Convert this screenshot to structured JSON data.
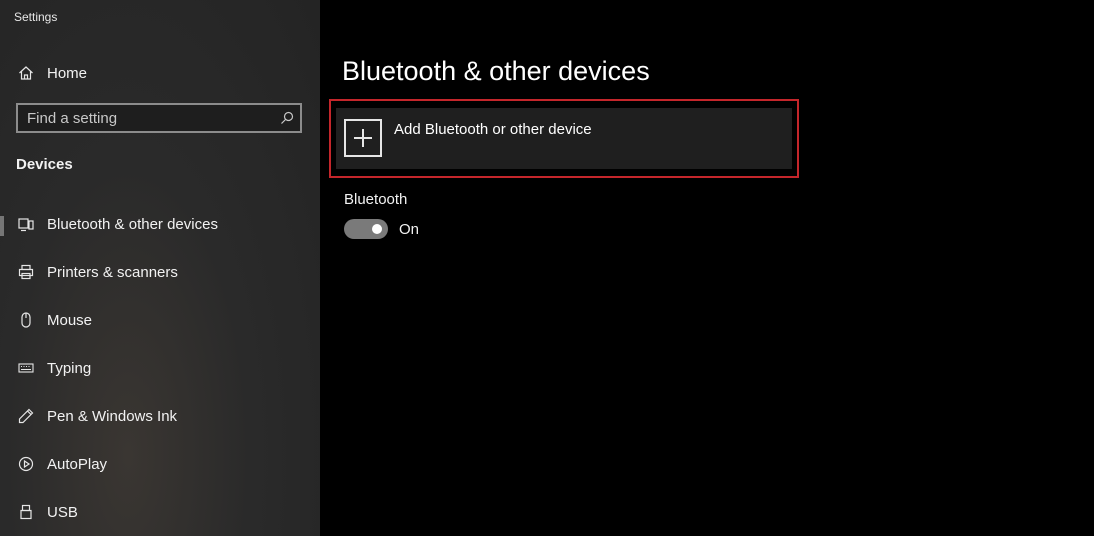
{
  "window": {
    "title": "Settings"
  },
  "sidebar": {
    "home_label": "Home",
    "search": {
      "placeholder": "Find a setting",
      "value": ""
    },
    "section_heading": "Devices",
    "items": [
      {
        "label": "Bluetooth & other devices",
        "icon": "bluetooth-devices-icon",
        "selected": true
      },
      {
        "label": "Printers & scanners",
        "icon": "printer-icon",
        "selected": false
      },
      {
        "label": "Mouse",
        "icon": "mouse-icon",
        "selected": false
      },
      {
        "label": "Typing",
        "icon": "keyboard-icon",
        "selected": false
      },
      {
        "label": "Pen & Windows Ink",
        "icon": "pen-icon",
        "selected": false
      },
      {
        "label": "AutoPlay",
        "icon": "autoplay-icon",
        "selected": false
      },
      {
        "label": "USB",
        "icon": "usb-icon",
        "selected": false
      }
    ]
  },
  "main": {
    "title": "Bluetooth & other devices",
    "add_device_label": "Add Bluetooth or other device",
    "bluetooth": {
      "label": "Bluetooth",
      "toggle_state": "On",
      "is_on": true
    }
  },
  "colors": {
    "highlight_border": "#c4262b",
    "sidebar_bg": "#2a2a2a",
    "main_bg": "#000000"
  }
}
